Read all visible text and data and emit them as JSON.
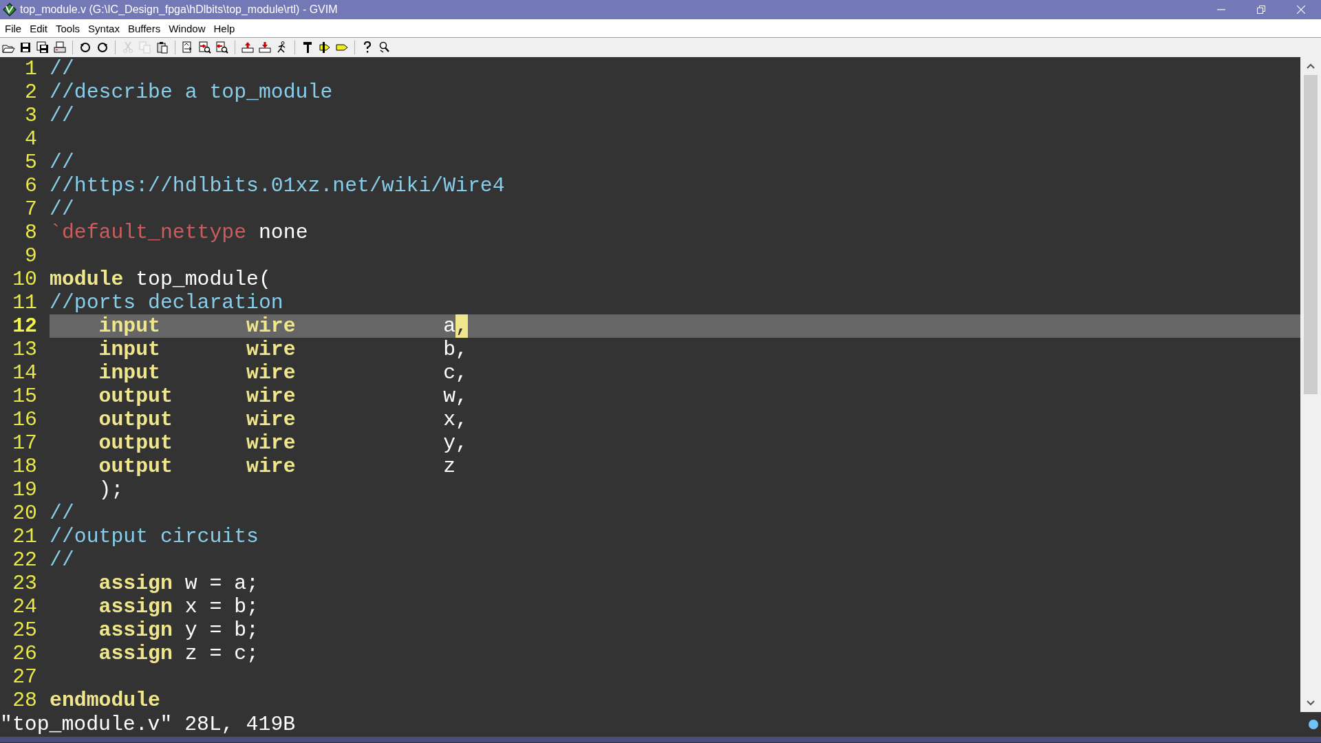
{
  "window": {
    "title": "top_module.v (G:\\IC_Design_fpga\\hDlbits\\top_module\\rtl) - GVIM"
  },
  "menu": [
    "File",
    "Edit",
    "Tools",
    "Syntax",
    "Buffers",
    "Window",
    "Help"
  ],
  "toolbar": {
    "groups": [
      [
        {
          "disabled": false
        },
        {
          "disabled": false
        },
        {
          "disabled": false
        },
        {
          "disabled": false
        }
      ],
      [
        {
          "disabled": false
        },
        {
          "disabled": false
        }
      ],
      [
        {
          "disabled": true
        },
        {
          "disabled": true
        },
        {
          "disabled": false
        }
      ],
      [
        {
          "disabled": false
        },
        {
          "disabled": false
        },
        {
          "disabled": false
        }
      ],
      [
        {
          "disabled": false
        },
        {
          "disabled": false
        },
        {
          "disabled": false
        }
      ],
      [
        {
          "disabled": false
        },
        {
          "disabled": false
        },
        {
          "disabled": false
        }
      ],
      [
        {
          "disabled": false
        },
        {
          "disabled": false
        }
      ]
    ]
  },
  "editor": {
    "lines": [
      {
        "number": "1",
        "current": false,
        "segments": [
          {
            "kind": "comment",
            "text": "//"
          }
        ]
      },
      {
        "number": "2",
        "current": false,
        "segments": [
          {
            "kind": "comment",
            "text": "//describe a top_module"
          }
        ]
      },
      {
        "number": "3",
        "current": false,
        "segments": [
          {
            "kind": "comment",
            "text": "//"
          }
        ]
      },
      {
        "number": "4",
        "current": false,
        "kind": "blank"
      },
      {
        "number": "5",
        "current": false,
        "segments": [
          {
            "kind": "comment",
            "text": "//"
          }
        ]
      },
      {
        "number": "6",
        "current": false,
        "segments": [
          {
            "kind": "comment",
            "text": "//https://hdlbits.01xz.net/wiki/Wire4"
          }
        ]
      },
      {
        "number": "7",
        "current": false,
        "segments": [
          {
            "kind": "comment",
            "text": "//"
          }
        ]
      },
      {
        "number": "8",
        "current": false,
        "segments": [
          {
            "kind": "directive",
            "text": "`default_nettype"
          },
          {
            "kind": "plain",
            "text": " none"
          }
        ]
      },
      {
        "number": "9",
        "current": false,
        "kind": "blank"
      },
      {
        "number": "10",
        "current": false,
        "segments": [
          {
            "kind": "keyword",
            "text": "module"
          },
          {
            "kind": "plain",
            "text": " top_module("
          }
        ]
      },
      {
        "number": "11",
        "current": false,
        "segments": [
          {
            "kind": "comment",
            "text": "//ports declaration"
          }
        ]
      },
      {
        "number": "12",
        "current": true,
        "kind": "port",
        "columns": [
          [
            {
              "kind": "keyword",
              "text": "input"
            }
          ],
          [
            {
              "kind": "keyword",
              "text": "wire"
            }
          ],
          [
            {
              "kind": "plain",
              "text": "a"
            },
            {
              "kind": "cursor",
              "text": ","
            }
          ]
        ]
      },
      {
        "number": "13",
        "current": false,
        "kind": "port",
        "columns": [
          [
            {
              "kind": "keyword",
              "text": "input"
            }
          ],
          [
            {
              "kind": "keyword",
              "text": "wire"
            }
          ],
          [
            {
              "kind": "plain",
              "text": "b,"
            }
          ]
        ]
      },
      {
        "number": "14",
        "current": false,
        "kind": "port",
        "columns": [
          [
            {
              "kind": "keyword",
              "text": "input"
            }
          ],
          [
            {
              "kind": "keyword",
              "text": "wire"
            }
          ],
          [
            {
              "kind": "plain",
              "text": "c,"
            }
          ]
        ]
      },
      {
        "number": "15",
        "current": false,
        "kind": "port",
        "columns": [
          [
            {
              "kind": "keyword",
              "text": "output"
            }
          ],
          [
            {
              "kind": "keyword",
              "text": "wire"
            }
          ],
          [
            {
              "kind": "plain",
              "text": "w,"
            }
          ]
        ]
      },
      {
        "number": "16",
        "current": false,
        "kind": "port",
        "columns": [
          [
            {
              "kind": "keyword",
              "text": "output"
            }
          ],
          [
            {
              "kind": "keyword",
              "text": "wire"
            }
          ],
          [
            {
              "kind": "plain",
              "text": "x,"
            }
          ]
        ]
      },
      {
        "number": "17",
        "current": false,
        "kind": "port",
        "columns": [
          [
            {
              "kind": "keyword",
              "text": "output"
            }
          ],
          [
            {
              "kind": "keyword",
              "text": "wire"
            }
          ],
          [
            {
              "kind": "plain",
              "text": "y,"
            }
          ]
        ]
      },
      {
        "number": "18",
        "current": false,
        "kind": "port",
        "columns": [
          [
            {
              "kind": "keyword",
              "text": "output"
            }
          ],
          [
            {
              "kind": "keyword",
              "text": "wire"
            }
          ],
          [
            {
              "kind": "plain",
              "text": "z"
            }
          ]
        ]
      },
      {
        "number": "19",
        "current": false,
        "kind": "code",
        "indented": true,
        "segments": [
          {
            "kind": "plain",
            "text": ");"
          }
        ]
      },
      {
        "number": "20",
        "current": false,
        "segments": [
          {
            "kind": "comment",
            "text": "//"
          }
        ]
      },
      {
        "number": "21",
        "current": false,
        "segments": [
          {
            "kind": "comment",
            "text": "//output circuits"
          }
        ]
      },
      {
        "number": "22",
        "current": false,
        "segments": [
          {
            "kind": "comment",
            "text": "//"
          }
        ]
      },
      {
        "number": "23",
        "current": false,
        "kind": "code",
        "indented": true,
        "segments": [
          {
            "kind": "keyword",
            "text": "assign"
          },
          {
            "kind": "plain",
            "text": " w = a;"
          }
        ]
      },
      {
        "number": "24",
        "current": false,
        "kind": "code",
        "indented": true,
        "segments": [
          {
            "kind": "keyword",
            "text": "assign"
          },
          {
            "kind": "plain",
            "text": " x = b;"
          }
        ]
      },
      {
        "number": "25",
        "current": false,
        "kind": "code",
        "indented": true,
        "segments": [
          {
            "kind": "keyword",
            "text": "assign"
          },
          {
            "kind": "plain",
            "text": " y = b;"
          }
        ]
      },
      {
        "number": "26",
        "current": false,
        "kind": "code",
        "indented": true,
        "segments": [
          {
            "kind": "keyword",
            "text": "assign"
          },
          {
            "kind": "plain",
            "text": " z = c;"
          }
        ]
      },
      {
        "number": "27",
        "current": false,
        "kind": "blank"
      },
      {
        "number": "28",
        "current": false,
        "segments": [
          {
            "kind": "keyword",
            "text": "endmodule"
          }
        ]
      }
    ]
  },
  "message_line": "\"top_module.v\" 28L, 419B"
}
